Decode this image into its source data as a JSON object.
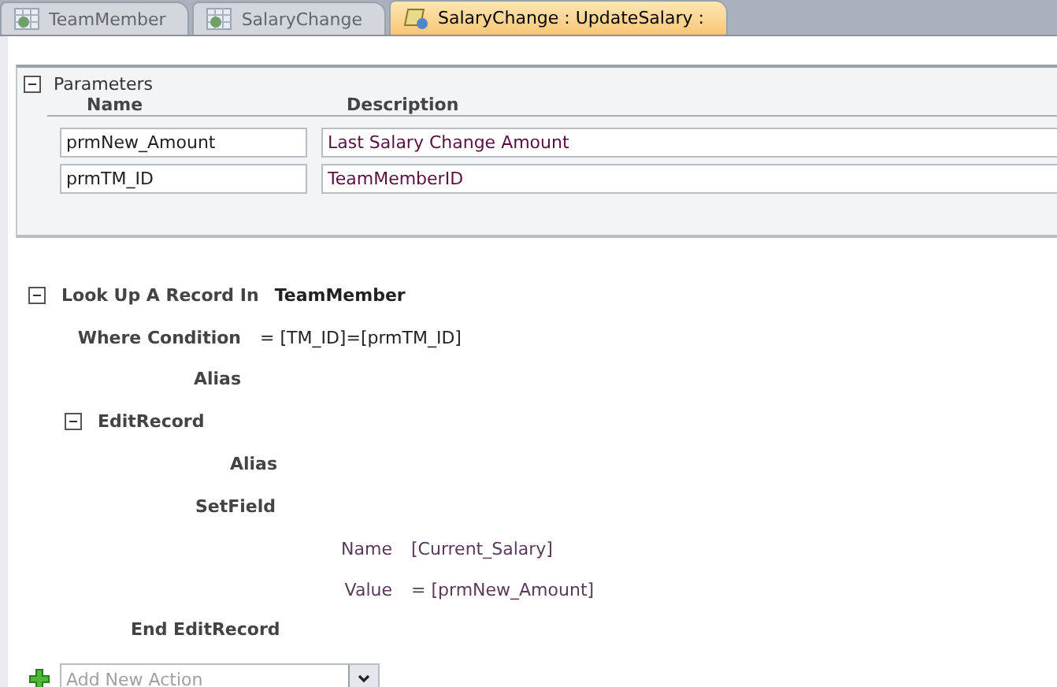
{
  "tabs": [
    {
      "label": "TeamMember",
      "kind": "table",
      "selected": false
    },
    {
      "label": "SalaryChange",
      "kind": "table",
      "selected": false
    },
    {
      "label": "SalaryChange : UpdateSalary :",
      "kind": "macro",
      "selected": true
    }
  ],
  "parameters": {
    "title": "Parameters",
    "expanded": true,
    "columns": [
      "Name",
      "Description"
    ],
    "rows": [
      {
        "name": "prmNew_Amount",
        "description": "Last Salary Change Amount"
      },
      {
        "name": "prmTM_ID",
        "description": "TeamMemberID"
      }
    ]
  },
  "macro": [
    {
      "kind": "block",
      "name": "Look Up A Record In",
      "target": "TeamMember",
      "expanded": true,
      "arguments": [
        {
          "label": "Where Condition",
          "value": "= [TM_ID]=[prmTM_ID]"
        },
        {
          "label": "Alias"
        }
      ],
      "children": [
        {
          "kind": "block",
          "name": "EditRecord",
          "expanded": true,
          "arguments": [
            {
              "label": "Alias"
            }
          ],
          "children": [
            {
              "kind": "action",
              "name": "SetField",
              "arguments": [
                {
                  "label": "Name",
                  "value": "[Current_Salary]"
                },
                {
                  "label": "Value",
                  "value": "= [prmNew_Amount]"
                }
              ]
            }
          ],
          "end_label": "End EditRecord"
        }
      ]
    }
  ],
  "add_action": {
    "placeholder": "Add New Action"
  }
}
